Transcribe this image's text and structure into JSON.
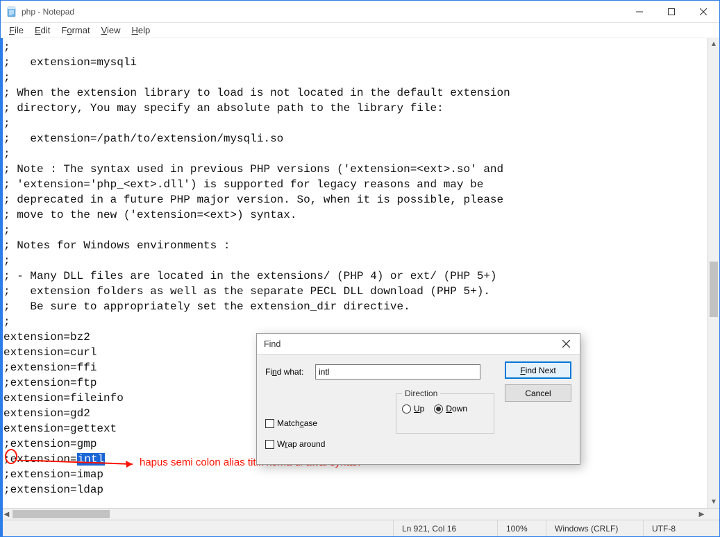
{
  "window": {
    "title": "php - Notepad"
  },
  "menu": {
    "file": "File",
    "edit": "Edit",
    "format": "Format",
    "view": "View",
    "help": "Help"
  },
  "editor": {
    "lines_before": [
      ";",
      ";   extension=mysqli",
      ";",
      "; When the extension library to load is not located in the default extension",
      "; directory, You may specify an absolute path to the library file:",
      ";",
      ";   extension=/path/to/extension/mysqli.so",
      ";",
      "; Note : The syntax used in previous PHP versions ('extension=<ext>.so' and",
      "; 'extension='php_<ext>.dll') is supported for legacy reasons and may be",
      "; deprecated in a future PHP major version. So, when it is possible, please",
      "; move to the new ('extension=<ext>) syntax.",
      ";",
      "; Notes for Windows environments :",
      ";",
      "; - Many DLL files are located in the extensions/ (PHP 4) or ext/ (PHP 5+)",
      ";   extension folders as well as the separate PECL DLL download (PHP 5+).",
      ";   Be sure to appropriately set the extension_dir directive.",
      ";",
      "extension=bz2",
      "extension=curl",
      ";extension=ffi",
      ";extension=ftp",
      "extension=fileinfo",
      "extension=gd2",
      "extension=gettext",
      ";extension=gmp"
    ],
    "highlight_line_prefix": ";extension=",
    "highlight_text": "intl",
    "lines_after": [
      ";extension=imap",
      ";extension=ldap"
    ]
  },
  "find": {
    "title": "Find",
    "label": "Find what:",
    "value": "intl",
    "match_case": "Match case",
    "wrap_around": "Wrap around",
    "direction_label": "Direction",
    "up": "Up",
    "down": "Down",
    "find_next": "Find Next",
    "cancel": "Cancel"
  },
  "status": {
    "position": "Ln 921, Col 16",
    "zoom": "100%",
    "line_ending": "Windows (CRLF)",
    "encoding": "UTF-8"
  },
  "annotation": {
    "text": "hapus semi colon alias titik koma di awal syntax"
  }
}
